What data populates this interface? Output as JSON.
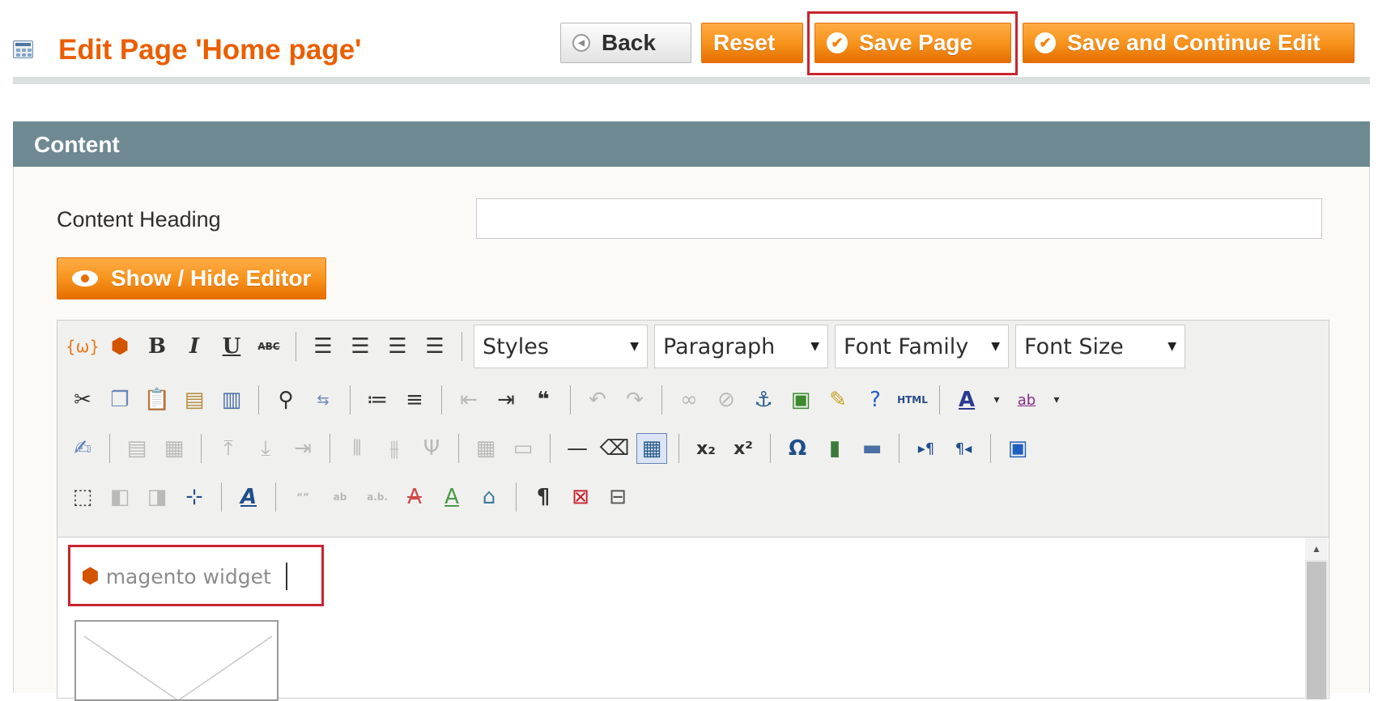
{
  "header": {
    "title": "Edit Page 'Home page'",
    "buttons": {
      "back": "Back",
      "reset": "Reset",
      "save": "Save Page",
      "save_continue": "Save and Continue Edit"
    }
  },
  "section": {
    "title": "Content",
    "content_heading_label": "Content Heading",
    "content_heading_value": "",
    "show_hide_editor": "Show / Hide Editor"
  },
  "toolbar": {
    "styles": "Styles",
    "format": "Paragraph",
    "font_family": "Font Family",
    "font_size": "Font Size",
    "html_label": "HTML"
  },
  "editor": {
    "widget_text": "magento widget"
  },
  "colors": {
    "accent_orange": "#eb5e00",
    "button_orange": "#f7941d",
    "section_header": "#6f8992",
    "highlight_red": "#c8242f"
  }
}
